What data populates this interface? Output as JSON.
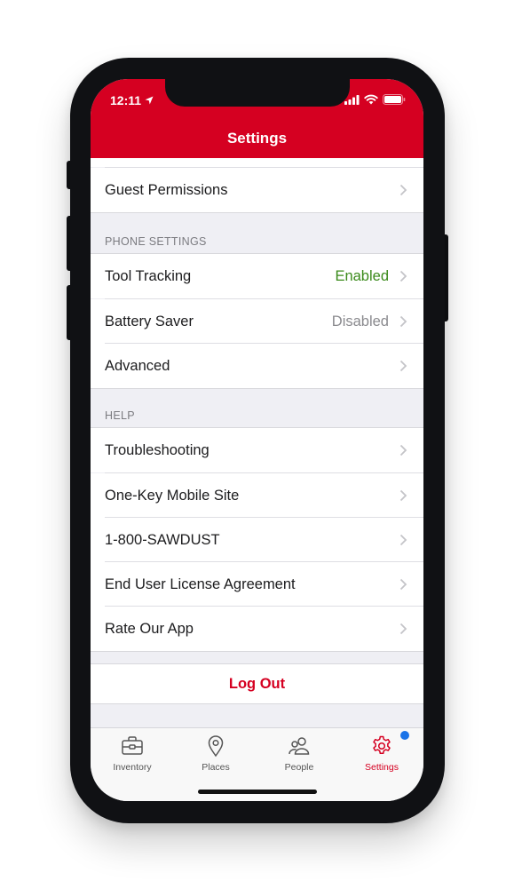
{
  "status_bar": {
    "time": "12:11"
  },
  "header": {
    "title": "Settings"
  },
  "rows_top": [
    {
      "label": "Guest Permissions"
    }
  ],
  "phone_settings": {
    "header": "PHONE SETTINGS",
    "items": [
      {
        "label": "Tool Tracking",
        "value": "Enabled",
        "value_color": "#3a8a1a"
      },
      {
        "label": "Battery Saver",
        "value": "Disabled",
        "value_color": "#8a8a8e"
      },
      {
        "label": "Advanced",
        "value": ""
      }
    ]
  },
  "help": {
    "header": "HELP",
    "items": [
      {
        "label": "Troubleshooting"
      },
      {
        "label": "One-Key Mobile Site"
      },
      {
        "label": "1-800-SAWDUST"
      },
      {
        "label": "End User License Agreement"
      },
      {
        "label": "Rate Our App"
      }
    ]
  },
  "logout": {
    "label": "Log Out"
  },
  "tabbar": {
    "tabs": [
      {
        "label": "Inventory",
        "icon": "briefcase-icon",
        "active": false
      },
      {
        "label": "Places",
        "icon": "map-pin-icon",
        "active": false
      },
      {
        "label": "People",
        "icon": "people-icon",
        "active": false
      },
      {
        "label": "Settings",
        "icon": "gear-icon",
        "active": true
      }
    ]
  },
  "colors": {
    "brand": "#d50021",
    "enabled": "#3a8a1a",
    "badge": "#1a73e8"
  }
}
